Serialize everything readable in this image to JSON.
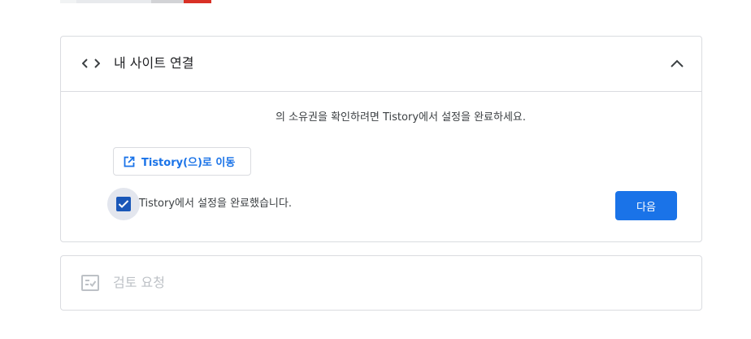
{
  "site_section": {
    "title": "내 사이트 연결",
    "header_icon": "code-icon",
    "collapse_icon": "chevron-up-icon",
    "description": "의 소유권을 확인하려면 Tistory에서 설정을 완료하세요.",
    "tistory_button": {
      "label": "Tistory(으)로 이동",
      "icon": "open-in-new-icon"
    },
    "checkbox": {
      "label": "Tistory에서 설정을 완료했습니다.",
      "checked": true
    },
    "next_button": {
      "label": "다음"
    }
  },
  "review_section": {
    "title": "검토 요청",
    "icon": "checklist-icon"
  },
  "colors": {
    "primary": "#1a73e8",
    "checkbox": "#1a57b8",
    "border": "#dadce0",
    "disabled_text": "#bdc1c6"
  }
}
